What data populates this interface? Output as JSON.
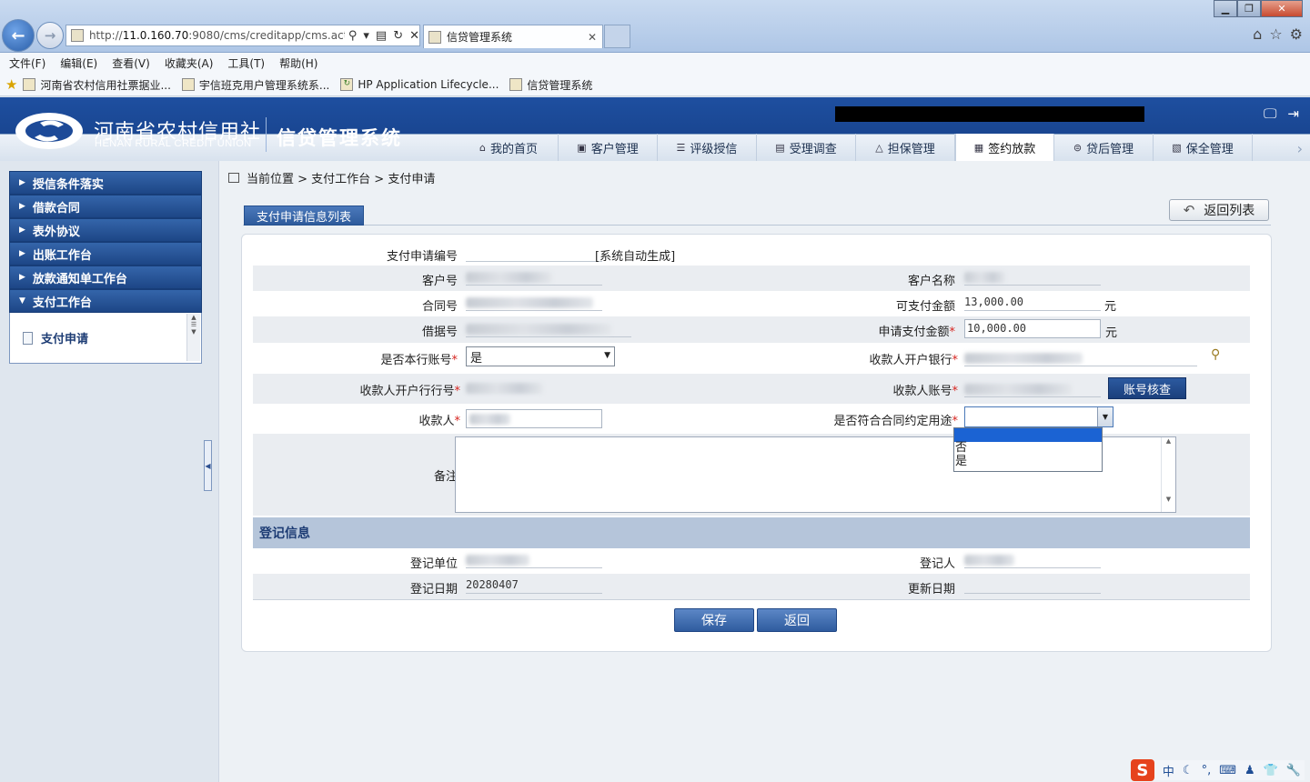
{
  "browser": {
    "url_prefix": "http://",
    "url_host": "11.0.160.70",
    "url_rest": ":9080/cms/creditapp/cms.actic",
    "tab_title": "信贷管理系统",
    "menu": [
      "文件(F)",
      "编辑(E)",
      "查看(V)",
      "收藏夹(A)",
      "工具(T)",
      "帮助(H)"
    ],
    "favorites": [
      "河南省农村信用社票据业...",
      "宇信班克用户管理系统系...",
      "HP Application Lifecycle...",
      "信贷管理系统"
    ]
  },
  "header": {
    "org_cn": "河南省农村信用社",
    "org_en": "HENAN RURAL CREDIT UNION",
    "system_name": "信贷管理系统",
    "nav": [
      "我的首页",
      "客户管理",
      "评级授信",
      "受理调查",
      "担保管理",
      "签约放款",
      "贷后管理",
      "保全管理"
    ],
    "active_nav": "签约放款"
  },
  "sidebar": {
    "items": [
      "授信条件落实",
      "借款合同",
      "表外协议",
      "出账工作台",
      "放款通知单工作台",
      "支付工作台"
    ],
    "expanded": "支付工作台",
    "sub_item": "支付申请"
  },
  "breadcrumb": "当前位置 > 支付工作台 > 支付申请",
  "panel": {
    "tab_label": "支付申请信息列表",
    "back_list_label": "返回列表"
  },
  "form": {
    "pay_no_label": "支付申请编号",
    "pay_no_hint": "[系统自动生成]",
    "cust_no_label": "客户号",
    "cust_name_label": "客户名称",
    "contract_no_label": "合同号",
    "avail_amount_label": "可支付金额",
    "avail_amount": "13,000.00",
    "unit": "元",
    "loan_no_label": "借据号",
    "apply_amount_label": "申请支付金额",
    "apply_amount": "10,000.00",
    "own_bank_label": "是否本行账号",
    "own_bank_value": "是",
    "payee_bank_label": "收款人开户银行",
    "payee_bank_no_label": "收款人开户行行号",
    "payee_acct_label": "收款人账号",
    "check_acct_label": "账号核查",
    "payee_label": "收款人",
    "purpose_label": "是否符合合同约定用途",
    "purpose_options": [
      "",
      "否",
      "是"
    ],
    "remark_label": "备注"
  },
  "registration": {
    "title": "登记信息",
    "unit_label": "登记单位",
    "person_label": "登记人",
    "date_label": "登记日期",
    "date_value": "20280407",
    "update_label": "更新日期"
  },
  "buttons": {
    "save": "保存",
    "back": "返回"
  },
  "tray": [
    "中",
    "☾",
    "°,",
    "⌨",
    "♟",
    "👕",
    "🔧"
  ]
}
